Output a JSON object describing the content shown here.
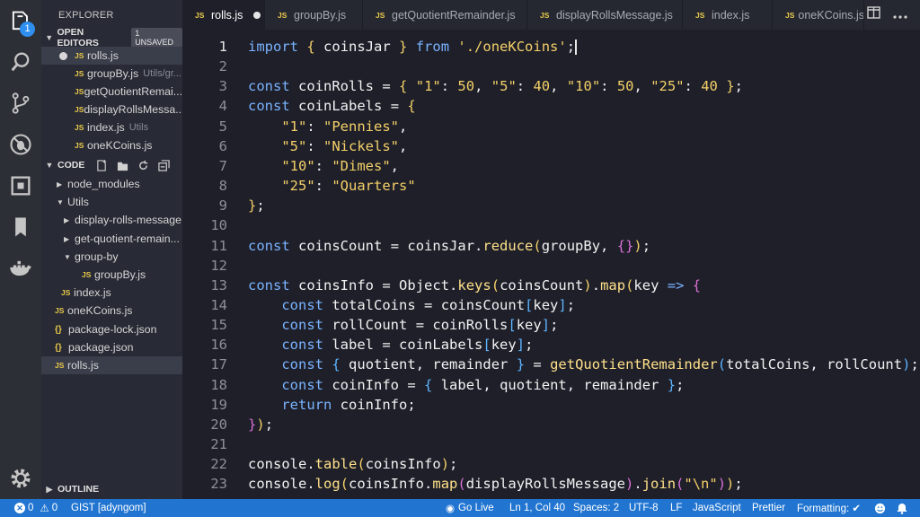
{
  "activity": {
    "items": [
      "explorer",
      "search",
      "source-control",
      "debug",
      "extensions",
      "bookmarks",
      "docker"
    ],
    "explorer_badge": "1",
    "settings": "settings"
  },
  "sidebar": {
    "title": "EXPLORER",
    "open_editors": {
      "label": "OPEN EDITORS",
      "badge": "1 UNSAVED",
      "items": [
        {
          "name": "rolls.js",
          "hint": ""
        },
        {
          "name": "groupBy.js",
          "hint": "Utils/gr..."
        },
        {
          "name": "getQuotientRemai...",
          "hint": ""
        },
        {
          "name": "displayRollsMessa...",
          "hint": ""
        },
        {
          "name": "index.js",
          "hint": "Utils"
        },
        {
          "name": "oneKCoins.js",
          "hint": ""
        }
      ]
    },
    "workspace": {
      "label": "CODE",
      "tree": {
        "node_modules": "node_modules",
        "utils": "Utils",
        "display_rolls": "display-rolls-message",
        "get_quotient": "get-quotient-remain...",
        "group_by": "group-by",
        "group_by_js": "groupBy.js",
        "index_js": "index.js",
        "onek": "oneKCoins.js",
        "pkg_lock": "package-lock.json",
        "pkg": "package.json",
        "rolls": "rolls.js"
      }
    },
    "outline_label": "OUTLINE"
  },
  "tabs": [
    {
      "label": "rolls.js",
      "active": true,
      "dirty": true
    },
    {
      "label": "groupBy.js"
    },
    {
      "label": "getQuotientRemainder.js"
    },
    {
      "label": "displayRollsMessage.js"
    },
    {
      "label": "index.js"
    },
    {
      "label": "oneKCoins.js"
    }
  ],
  "editor": {
    "line_numbers": [
      "1",
      "2",
      "3",
      "4",
      "5",
      "6",
      "7",
      "8",
      "9",
      "10",
      "11",
      "12",
      "13",
      "14",
      "15",
      "16",
      "17",
      "18",
      "19",
      "20",
      "21",
      "22",
      "23"
    ],
    "lines": [
      "import { coinsJar } from './oneKCoins';",
      "",
      "const coinRolls = { \"1\": 50, \"5\": 40, \"10\": 50, \"25\": 40 };",
      "const coinLabels = {",
      "    \"1\": \"Pennies\",",
      "    \"5\": \"Nickels\",",
      "    \"10\": \"Dimes\",",
      "    \"25\": \"Quarters\"",
      "};",
      "",
      "const coinsCount = coinsJar.reduce(groupBy, {});",
      "",
      "const coinsInfo = Object.keys(coinsCount).map(key => {",
      "    const totalCoins = coinsCount[key];",
      "    const rollCount = coinRolls[key];",
      "    const label = coinLabels[key];",
      "    const { quotient, remainder } = getQuotientRemainder(totalCoins, rollCount);",
      "    const coinInfo = { label, quotient, remainder };",
      "    return coinInfo;",
      "});",
      "",
      "console.table(coinsInfo);",
      "console.log(coinsInfo.map(displayRollsMessage).join(\"\\n\"));"
    ]
  },
  "status": {
    "errors": "0",
    "warnings": "0",
    "gist": "GIST [adyngom]",
    "go_live": "Go Live",
    "position": "Ln 1, Col 40",
    "spaces": "Spaces: 2",
    "encoding": "UTF-8",
    "eol": "LF",
    "language": "JavaScript",
    "prettier": "Prettier",
    "formatting": "Formatting: ✔"
  }
}
